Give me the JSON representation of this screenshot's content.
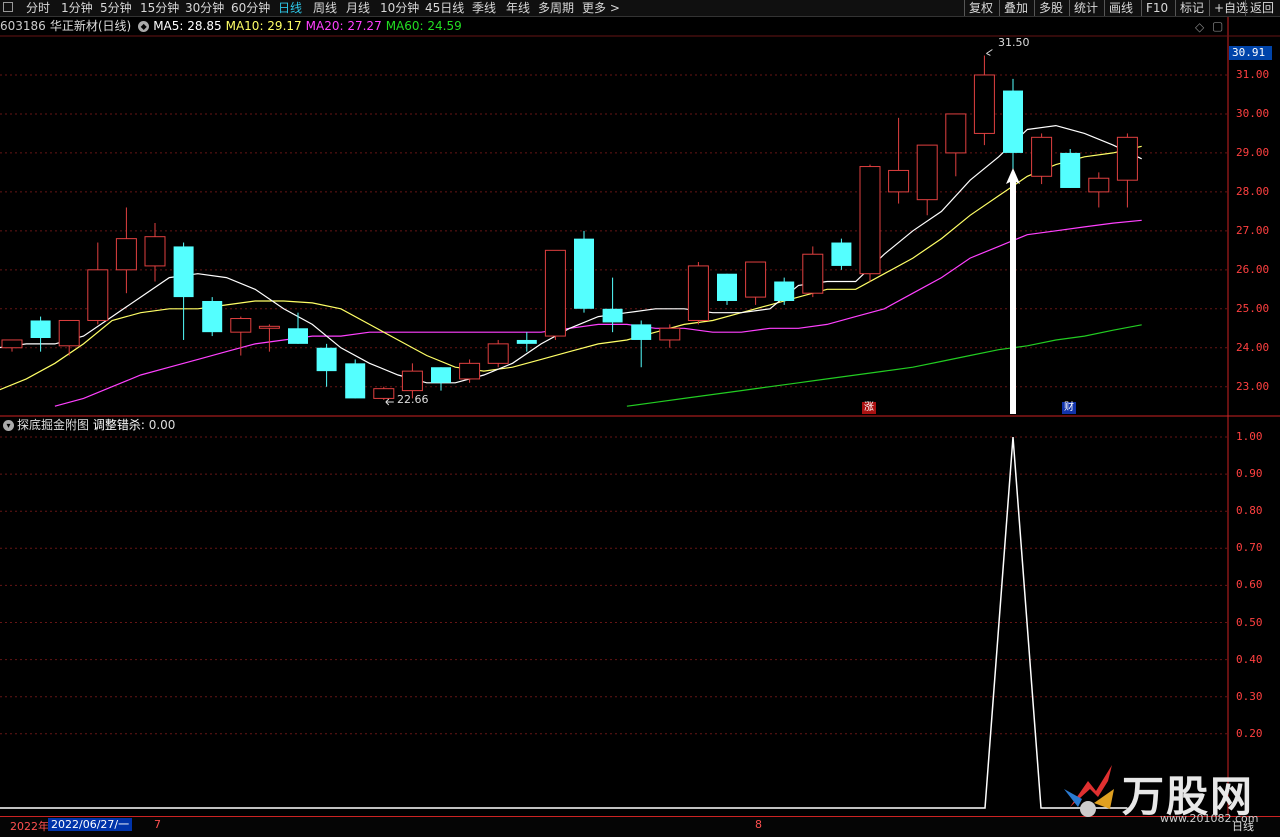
{
  "toolbar": {
    "menu_icon": "window-menu-icon",
    "periods": [
      "分时",
      "1分钟",
      "5分钟",
      "15分钟",
      "30分钟",
      "60分钟",
      "日线",
      "周线",
      "月线",
      "10分钟",
      "45日线",
      "季线",
      "年线",
      "多周期",
      "更多 >"
    ],
    "active_period": "日线",
    "right_buttons": [
      "复权",
      "叠加",
      "多股",
      "统计",
      "画线",
      "F10",
      "标记",
      "+自选",
      "返回"
    ]
  },
  "stock": {
    "code": "603186",
    "name": "华正新材(日线)",
    "ma5_label": "MA5: 28.85",
    "ma10_label": "MA10: 29.17",
    "ma20_label": "MA20: 27.27",
    "ma60_label": "MA60: 24.59",
    "high_label": "31.50",
    "low_label": "22.66",
    "current_price": "30.91",
    "marker_zhang": "涨",
    "marker_cai": "财"
  },
  "indicator": {
    "name": "探底掘金附图",
    "param_label": "调整错杀:",
    "param_value": "0.00"
  },
  "colors": {
    "up": "#e04040",
    "down": "#54ffff",
    "ma5": "#ffffff",
    "ma10": "#ffff66",
    "ma20": "#ff40ff",
    "ma60": "#22cc22",
    "axis": "#ff4040",
    "grid": "#661515"
  },
  "price_axis": [
    "31.00",
    "30.00",
    "29.00",
    "28.00",
    "27.00",
    "26.00",
    "25.00",
    "24.00",
    "23.00"
  ],
  "ind_axis": [
    "1.00",
    "0.90",
    "0.80",
    "0.70",
    "0.60",
    "0.50",
    "0.40",
    "0.30",
    "0.20"
  ],
  "chart_data": {
    "type": "candlestick",
    "ylim": [
      22.3,
      32.0
    ],
    "candles": [
      {
        "o": 24.0,
        "h": 24.2,
        "l": 23.9,
        "c": 24.2
      },
      {
        "o": 24.7,
        "h": 24.8,
        "l": 23.9,
        "c": 24.25
      },
      {
        "o": 24.05,
        "h": 24.7,
        "l": 23.8,
        "c": 24.7
      },
      {
        "o": 24.7,
        "h": 26.7,
        "l": 24.6,
        "c": 26.0
      },
      {
        "o": 26.0,
        "h": 27.6,
        "l": 25.4,
        "c": 26.8
      },
      {
        "o": 26.1,
        "h": 27.2,
        "l": 25.7,
        "c": 26.85
      },
      {
        "o": 26.6,
        "h": 26.7,
        "l": 24.2,
        "c": 25.3
      },
      {
        "o": 25.2,
        "h": 25.3,
        "l": 24.3,
        "c": 24.4
      },
      {
        "o": 24.4,
        "h": 24.8,
        "l": 23.8,
        "c": 24.75
      },
      {
        "o": 24.5,
        "h": 24.6,
        "l": 23.9,
        "c": 24.55
      },
      {
        "o": 24.5,
        "h": 24.9,
        "l": 24.1,
        "c": 24.1
      },
      {
        "o": 24.0,
        "h": 24.1,
        "l": 23.0,
        "c": 23.4
      },
      {
        "o": 23.6,
        "h": 23.7,
        "l": 22.7,
        "c": 22.7
      },
      {
        "o": 22.7,
        "h": 23.0,
        "l": 22.66,
        "c": 22.95
      },
      {
        "o": 22.9,
        "h": 23.6,
        "l": 22.7,
        "c": 23.4
      },
      {
        "o": 23.5,
        "h": 23.5,
        "l": 22.9,
        "c": 23.1
      },
      {
        "o": 23.2,
        "h": 23.7,
        "l": 23.1,
        "c": 23.6
      },
      {
        "o": 23.6,
        "h": 24.2,
        "l": 23.5,
        "c": 24.1
      },
      {
        "o": 24.2,
        "h": 24.4,
        "l": 23.9,
        "c": 24.1
      },
      {
        "o": 24.3,
        "h": 26.5,
        "l": 24.2,
        "c": 26.5
      },
      {
        "o": 26.8,
        "h": 27.0,
        "l": 24.9,
        "c": 25.0
      },
      {
        "o": 25.0,
        "h": 25.8,
        "l": 24.4,
        "c": 24.65
      },
      {
        "o": 24.6,
        "h": 24.7,
        "l": 23.5,
        "c": 24.2
      },
      {
        "o": 24.2,
        "h": 24.6,
        "l": 24.0,
        "c": 24.5
      },
      {
        "o": 24.7,
        "h": 26.2,
        "l": 24.6,
        "c": 26.1
      },
      {
        "o": 25.9,
        "h": 25.9,
        "l": 25.1,
        "c": 25.2
      },
      {
        "o": 25.3,
        "h": 26.2,
        "l": 25.1,
        "c": 26.2
      },
      {
        "o": 25.7,
        "h": 25.8,
        "l": 25.1,
        "c": 25.2
      },
      {
        "o": 25.4,
        "h": 26.6,
        "l": 25.3,
        "c": 26.4
      },
      {
        "o": 26.7,
        "h": 26.8,
        "l": 26.0,
        "c": 26.1
      },
      {
        "o": 25.9,
        "h": 28.7,
        "l": 25.7,
        "c": 28.65
      },
      {
        "o": 28.0,
        "h": 29.9,
        "l": 27.7,
        "c": 28.55
      },
      {
        "o": 27.8,
        "h": 29.2,
        "l": 27.4,
        "c": 29.2
      },
      {
        "o": 29.0,
        "h": 30.0,
        "l": 28.4,
        "c": 30.0
      },
      {
        "o": 29.5,
        "h": 31.5,
        "l": 29.2,
        "c": 31.0
      },
      {
        "o": 30.6,
        "h": 30.9,
        "l": 28.5,
        "c": 29.0
      },
      {
        "o": 28.4,
        "h": 29.5,
        "l": 28.2,
        "c": 29.4
      },
      {
        "o": 29.0,
        "h": 29.1,
        "l": 28.1,
        "c": 28.1
      },
      {
        "o": 28.0,
        "h": 28.5,
        "l": 27.6,
        "c": 28.35
      },
      {
        "o": 28.3,
        "h": 29.5,
        "l": 27.6,
        "c": 29.4
      }
    ],
    "ma5": [
      24.0,
      24.1,
      24.1,
      24.3,
      24.8,
      25.3,
      25.8,
      25.9,
      25.8,
      25.5,
      25.0,
      24.6,
      24.0,
      23.6,
      23.3,
      23.1,
      23.1,
      23.3,
      23.6,
      24.1,
      24.5,
      24.8,
      24.9,
      25.0,
      25.0,
      24.9,
      24.9,
      25.0,
      25.6,
      25.7,
      25.7,
      26.4,
      27.0,
      27.5,
      28.3,
      28.9,
      29.6,
      29.7,
      29.5,
      29.2,
      28.85
    ],
    "ma10": [
      22.9,
      23.2,
      23.6,
      24.1,
      24.7,
      24.9,
      25.0,
      25.0,
      25.1,
      25.2,
      25.2,
      25.15,
      25.0,
      24.6,
      24.2,
      23.8,
      23.5,
      23.4,
      23.5,
      23.7,
      23.9,
      24.1,
      24.2,
      24.4,
      24.6,
      24.7,
      24.9,
      25.1,
      25.3,
      25.5,
      25.5,
      25.9,
      26.3,
      26.8,
      27.4,
      27.9,
      28.4,
      28.7,
      28.9,
      29.0,
      29.17
    ],
    "ma20": [
      null,
      null,
      22.5,
      22.7,
      23.0,
      23.3,
      23.5,
      23.7,
      23.9,
      24.1,
      24.2,
      24.3,
      24.3,
      24.4,
      24.4,
      24.4,
      24.4,
      24.4,
      24.4,
      24.4,
      24.5,
      24.6,
      24.6,
      24.5,
      24.5,
      24.4,
      24.4,
      24.5,
      24.5,
      24.6,
      24.8,
      25.0,
      25.4,
      25.8,
      26.3,
      26.6,
      26.9,
      27.0,
      27.1,
      27.2,
      27.27
    ],
    "ma60": [
      null,
      null,
      null,
      null,
      null,
      null,
      null,
      null,
      null,
      null,
      null,
      null,
      null,
      null,
      null,
      null,
      null,
      null,
      null,
      null,
      null,
      null,
      22.5,
      22.6,
      22.7,
      22.8,
      22.9,
      23.0,
      23.1,
      23.2,
      23.3,
      23.4,
      23.5,
      23.65,
      23.8,
      23.95,
      24.05,
      24.2,
      24.3,
      24.45,
      24.59
    ],
    "indicator": {
      "ylim": [
        0,
        1.05
      ],
      "values": [
        0,
        0,
        0,
        0,
        0,
        0,
        0,
        0,
        0,
        0,
        0,
        0,
        0,
        0,
        0,
        0,
        0,
        0,
        0,
        0,
        0,
        0,
        0,
        0,
        0,
        0,
        0,
        0,
        0,
        0,
        0,
        0,
        0,
        0,
        0,
        1.0,
        0,
        0,
        0,
        0
      ]
    }
  },
  "bottom": {
    "year": "2022年",
    "date": "2022/06/27/一",
    "m7": "7",
    "m8": "8",
    "right_label": "日线"
  },
  "watermark": {
    "logo": "wangu-logo-icon",
    "name": "万股网",
    "url": "www.201082.com"
  }
}
